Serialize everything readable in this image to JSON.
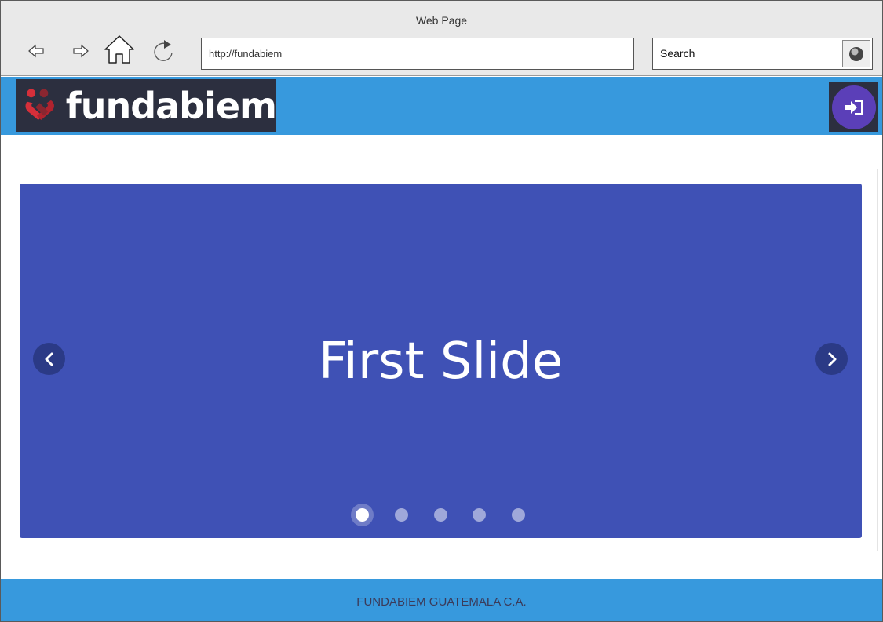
{
  "browser": {
    "window_title": "Web Page",
    "url": "http://fundabiem",
    "search_placeholder": "Search",
    "icons": [
      "back-arrow-icon",
      "forward-arrow-icon",
      "home-icon",
      "reload-icon",
      "search-icon"
    ]
  },
  "header": {
    "logo_text": "fundabiem",
    "logo_icon": "linked-hearts-icon",
    "login_icon": "sign-in-icon",
    "colors": {
      "bar": "#3799dd",
      "logo_bg": "#2c2f3f",
      "login_button": "#5b3fb8"
    }
  },
  "carousel": {
    "slide_title": "First Slide",
    "slide_count": 5,
    "active_index": 0,
    "prev_icon": "chevron-left-icon",
    "next_icon": "chevron-right-icon",
    "colors": {
      "slide_bg": "#3f51b5",
      "arrow_bg": "#2b3a86"
    }
  },
  "footer": {
    "text": "FUNDABIEM GUATEMALA C.A.",
    "color": "#3799dd"
  }
}
